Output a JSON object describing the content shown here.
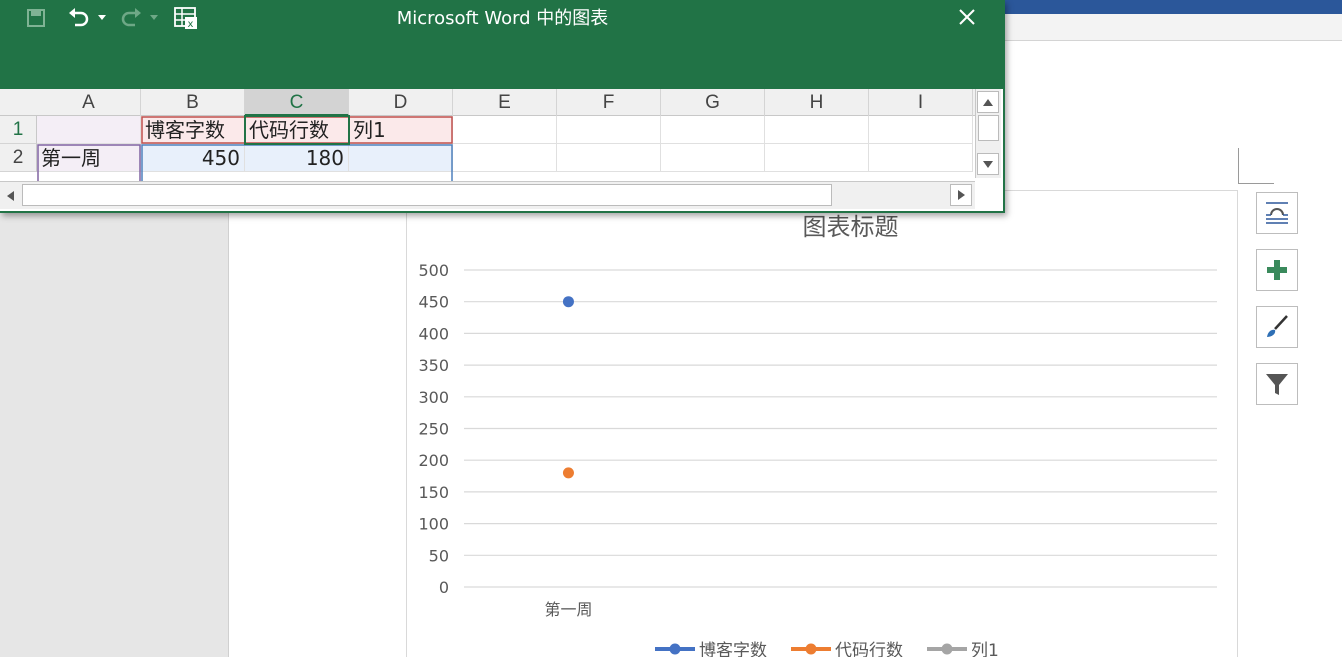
{
  "window": {
    "title": "Microsoft Word 中的图表"
  },
  "sheet": {
    "columns": [
      "A",
      "B",
      "C",
      "D",
      "E",
      "F",
      "G",
      "H",
      "I"
    ],
    "selected_column": "C",
    "rows": [
      "1",
      "2"
    ],
    "cells": {
      "A1": "",
      "B1": "博客字数",
      "C1": "代码行数",
      "D1": "列1",
      "A2": "第一周",
      "B2": "450",
      "C2": "180",
      "D2": ""
    }
  },
  "chart_data": {
    "type": "scatter",
    "title": "图表标题",
    "categories": [
      "第一周"
    ],
    "ylim": [
      0,
      500
    ],
    "yticks": [
      "500",
      "450",
      "400",
      "350",
      "300",
      "250",
      "200",
      "150",
      "100",
      "50",
      "0"
    ],
    "grid": true,
    "legend_position": "bottom",
    "series": [
      {
        "name": "博客字数",
        "values": [
          450
        ],
        "color": "#4472c4"
      },
      {
        "name": "代码行数",
        "values": [
          180
        ],
        "color": "#ed7d31"
      },
      {
        "name": "列1",
        "values": [
          null
        ],
        "color": "#a5a5a5"
      }
    ]
  },
  "side_buttons": [
    "layout-options-icon",
    "chart-elements-icon",
    "chart-styles-icon",
    "chart-filters-icon"
  ]
}
